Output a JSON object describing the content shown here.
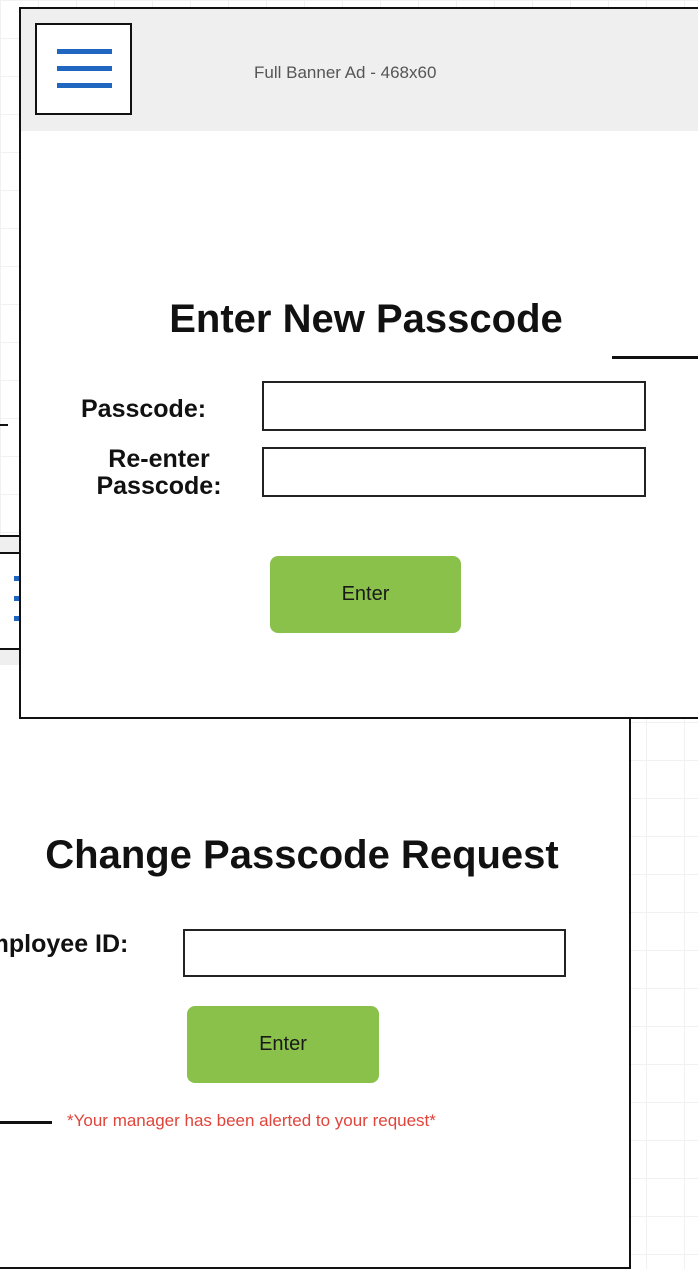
{
  "front_screen": {
    "header": {
      "ad_text": "Full Banner Ad - 468x60"
    },
    "title": "Enter New Passcode",
    "passcode_label": "Passcode:",
    "reenter_label_line1": "Re-enter",
    "reenter_label_line2": "Passcode:",
    "passcode_value": "",
    "reenter_value": "",
    "enter_label": "Enter"
  },
  "back_screen": {
    "title": "Change Passcode Request",
    "employee_label": "Employee ID:",
    "employee_value": "",
    "enter_label": "Enter",
    "alert": "*Your manager has been alerted to your request*"
  },
  "colors": {
    "accent_blue": "#1f66c1",
    "button_green": "#89c14a",
    "alert_red": "#e0443a",
    "header_gray": "#efefef"
  }
}
